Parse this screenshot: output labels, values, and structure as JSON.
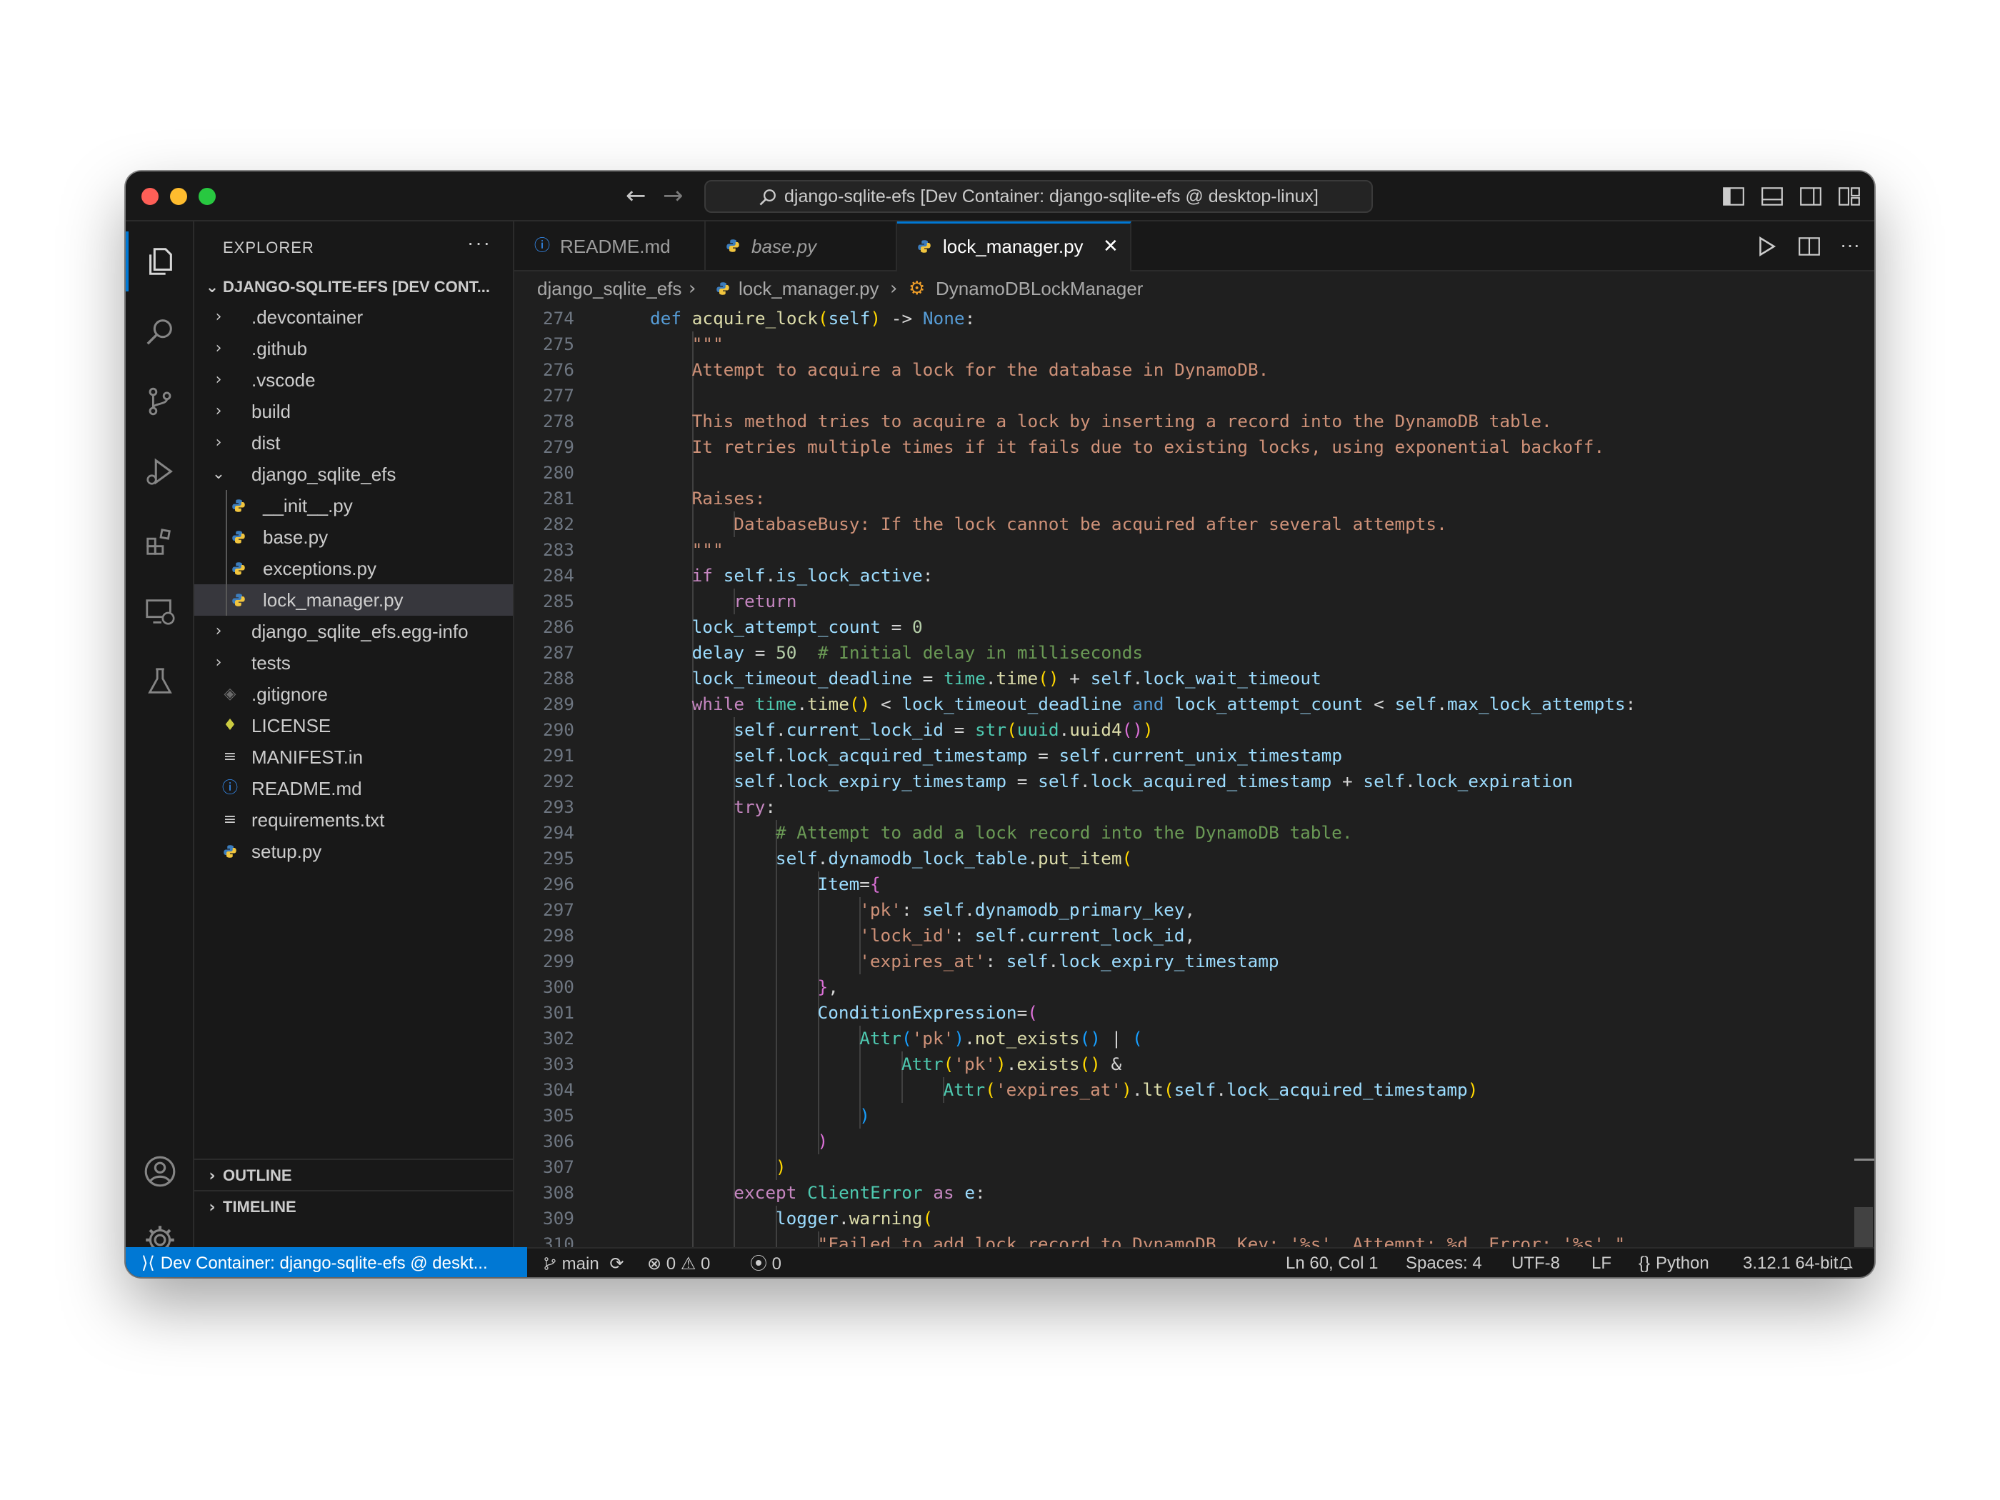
{
  "window": {
    "command_center": "django-sqlite-efs [Dev Container: django-sqlite-efs @ desktop-linux]"
  },
  "sidebar": {
    "header": "EXPLORER",
    "root": "DJANGO-SQLITE-EFS [DEV CONT...",
    "items": [
      {
        "label": ".devcontainer",
        "kind": "folder"
      },
      {
        "label": ".github",
        "kind": "folder"
      },
      {
        "label": ".vscode",
        "kind": "folder"
      },
      {
        "label": "build",
        "kind": "folder"
      },
      {
        "label": "dist",
        "kind": "folder"
      },
      {
        "label": "django_sqlite_efs",
        "kind": "folder-open"
      },
      {
        "label": "__init__.py",
        "kind": "python"
      },
      {
        "label": "base.py",
        "kind": "python"
      },
      {
        "label": "exceptions.py",
        "kind": "python"
      },
      {
        "label": "lock_manager.py",
        "kind": "python"
      },
      {
        "label": "django_sqlite_efs.egg-info",
        "kind": "folder"
      },
      {
        "label": "tests",
        "kind": "folder"
      },
      {
        "label": ".gitignore",
        "kind": "git"
      },
      {
        "label": "LICENSE",
        "kind": "license"
      },
      {
        "label": "MANIFEST.in",
        "kind": "text"
      },
      {
        "label": "README.md",
        "kind": "info"
      },
      {
        "label": "requirements.txt",
        "kind": "text"
      },
      {
        "label": "setup.py",
        "kind": "python"
      }
    ],
    "outline": "OUTLINE",
    "timeline": "TIMELINE"
  },
  "tabs": [
    {
      "label": "README.md",
      "icon": "info-icon"
    },
    {
      "label": "base.py",
      "icon": "python-icon"
    },
    {
      "label": "lock_manager.py",
      "icon": "python-icon",
      "active": true
    }
  ],
  "breadcrumb": {
    "folder": "django_sqlite_efs",
    "file": "lock_manager.py",
    "symbol": "DynamoDBLockManager"
  },
  "code": {
    "lines": [
      {
        "n": "274",
        "indent": 1,
        "tokens": [
          [
            "k",
            "def "
          ],
          [
            "f",
            "acquire_lock"
          ],
          [
            "p",
            "("
          ],
          [
            "v",
            "self"
          ],
          [
            "p",
            ")"
          ],
          [
            "o",
            " -> "
          ],
          [
            "k",
            "None"
          ],
          [
            "o",
            ":"
          ]
        ]
      },
      {
        "n": "275",
        "indent": 2,
        "tokens": [
          [
            "s",
            "\"\"\""
          ]
        ]
      },
      {
        "n": "276",
        "indent": 2,
        "tokens": [
          [
            "s",
            "Attempt to acquire a lock for the database in DynamoDB."
          ]
        ]
      },
      {
        "n": "277",
        "indent": 2,
        "tokens": []
      },
      {
        "n": "278",
        "indent": 2,
        "tokens": [
          [
            "s",
            "This method tries to acquire a lock by inserting a record into the DynamoDB table."
          ]
        ]
      },
      {
        "n": "279",
        "indent": 2,
        "tokens": [
          [
            "s",
            "It retries multiple times if it fails due to existing locks, using exponential backoff."
          ]
        ]
      },
      {
        "n": "280",
        "indent": 2,
        "tokens": []
      },
      {
        "n": "281",
        "indent": 2,
        "tokens": [
          [
            "s",
            "Raises:"
          ]
        ]
      },
      {
        "n": "282",
        "indent": 3,
        "tokens": [
          [
            "s",
            "DatabaseBusy: If the lock cannot be acquired after several attempts."
          ]
        ]
      },
      {
        "n": "283",
        "indent": 2,
        "tokens": [
          [
            "s",
            "\"\"\""
          ]
        ]
      },
      {
        "n": "284",
        "indent": 2,
        "tokens": [
          [
            "kc",
            "if "
          ],
          [
            "v",
            "self"
          ],
          [
            "o",
            "."
          ],
          [
            "v",
            "is_lock_active"
          ],
          [
            "o",
            ":"
          ]
        ]
      },
      {
        "n": "285",
        "indent": 3,
        "tokens": [
          [
            "kc",
            "return"
          ]
        ]
      },
      {
        "n": "286",
        "indent": 2,
        "tokens": [
          [
            "v",
            "lock_attempt_count"
          ],
          [
            "o",
            " = "
          ],
          [
            "n",
            "0"
          ]
        ]
      },
      {
        "n": "287",
        "indent": 2,
        "tokens": [
          [
            "v",
            "delay"
          ],
          [
            "o",
            " = "
          ],
          [
            "n",
            "50"
          ],
          [
            "c",
            "  # Initial delay in milliseconds"
          ]
        ]
      },
      {
        "n": "288",
        "indent": 2,
        "tokens": [
          [
            "v",
            "lock_timeout_deadline"
          ],
          [
            "o",
            " = "
          ],
          [
            "t",
            "time"
          ],
          [
            "o",
            "."
          ],
          [
            "f",
            "time"
          ],
          [
            "p",
            "()"
          ],
          [
            "o",
            " + "
          ],
          [
            "v",
            "self"
          ],
          [
            "o",
            "."
          ],
          [
            "v",
            "lock_wait_timeout"
          ]
        ]
      },
      {
        "n": "289",
        "indent": 2,
        "tokens": [
          [
            "kc",
            "while "
          ],
          [
            "t",
            "time"
          ],
          [
            "o",
            "."
          ],
          [
            "f",
            "time"
          ],
          [
            "p",
            "()"
          ],
          [
            "o",
            " < "
          ],
          [
            "v",
            "lock_timeout_deadline"
          ],
          [
            "k",
            " and "
          ],
          [
            "v",
            "lock_attempt_count"
          ],
          [
            "o",
            " < "
          ],
          [
            "v",
            "self"
          ],
          [
            "o",
            "."
          ],
          [
            "v",
            "max_lock_attempts"
          ],
          [
            "o",
            ":"
          ]
        ]
      },
      {
        "n": "290",
        "indent": 3,
        "tokens": [
          [
            "v",
            "self"
          ],
          [
            "o",
            "."
          ],
          [
            "v",
            "current_lock_id"
          ],
          [
            "o",
            " = "
          ],
          [
            "t",
            "str"
          ],
          [
            "p",
            "("
          ],
          [
            "t",
            "uuid"
          ],
          [
            "o",
            "."
          ],
          [
            "f",
            "uuid4"
          ],
          [
            "pp",
            "()"
          ],
          [
            "p",
            ")"
          ]
        ]
      },
      {
        "n": "291",
        "indent": 3,
        "tokens": [
          [
            "v",
            "self"
          ],
          [
            "o",
            "."
          ],
          [
            "v",
            "lock_acquired_timestamp"
          ],
          [
            "o",
            " = "
          ],
          [
            "v",
            "self"
          ],
          [
            "o",
            "."
          ],
          [
            "v",
            "current_unix_timestamp"
          ]
        ]
      },
      {
        "n": "292",
        "indent": 3,
        "tokens": [
          [
            "v",
            "self"
          ],
          [
            "o",
            "."
          ],
          [
            "v",
            "lock_expiry_timestamp"
          ],
          [
            "o",
            " = "
          ],
          [
            "v",
            "self"
          ],
          [
            "o",
            "."
          ],
          [
            "v",
            "lock_acquired_timestamp"
          ],
          [
            "o",
            " + "
          ],
          [
            "v",
            "self"
          ],
          [
            "o",
            "."
          ],
          [
            "v",
            "lock_expiration"
          ]
        ]
      },
      {
        "n": "293",
        "indent": 3,
        "tokens": [
          [
            "kc",
            "try"
          ],
          [
            "o",
            ":"
          ]
        ]
      },
      {
        "n": "294",
        "indent": 4,
        "tokens": [
          [
            "c",
            "# Attempt to add a lock record into the DynamoDB table."
          ]
        ]
      },
      {
        "n": "295",
        "indent": 4,
        "tokens": [
          [
            "v",
            "self"
          ],
          [
            "o",
            "."
          ],
          [
            "v",
            "dynamodb_lock_table"
          ],
          [
            "o",
            "."
          ],
          [
            "f",
            "put_item"
          ],
          [
            "p",
            "("
          ]
        ]
      },
      {
        "n": "296",
        "indent": 5,
        "tokens": [
          [
            "v",
            "Item"
          ],
          [
            "o",
            "="
          ],
          [
            "pp",
            "{"
          ]
        ]
      },
      {
        "n": "297",
        "indent": 6,
        "tokens": [
          [
            "s",
            "'pk'"
          ],
          [
            "o",
            ": "
          ],
          [
            "v",
            "self"
          ],
          [
            "o",
            "."
          ],
          [
            "v",
            "dynamodb_primary_key"
          ],
          [
            "o",
            ","
          ]
        ]
      },
      {
        "n": "298",
        "indent": 6,
        "tokens": [
          [
            "s",
            "'lock_id'"
          ],
          [
            "o",
            ": "
          ],
          [
            "v",
            "self"
          ],
          [
            "o",
            "."
          ],
          [
            "v",
            "current_lock_id"
          ],
          [
            "o",
            ","
          ]
        ]
      },
      {
        "n": "299",
        "indent": 6,
        "tokens": [
          [
            "s",
            "'expires_at'"
          ],
          [
            "o",
            ": "
          ],
          [
            "v",
            "self"
          ],
          [
            "o",
            "."
          ],
          [
            "v",
            "lock_expiry_timestamp"
          ]
        ]
      },
      {
        "n": "300",
        "indent": 5,
        "tokens": [
          [
            "pp",
            "}"
          ],
          [
            "o",
            ","
          ]
        ]
      },
      {
        "n": "301",
        "indent": 5,
        "tokens": [
          [
            "v",
            "ConditionExpression"
          ],
          [
            "o",
            "="
          ],
          [
            "pp",
            "("
          ]
        ]
      },
      {
        "n": "302",
        "indent": 6,
        "tokens": [
          [
            "t",
            "Attr"
          ],
          [
            "pb",
            "("
          ],
          [
            "s",
            "'pk'"
          ],
          [
            "pb",
            ")"
          ],
          [
            "o",
            "."
          ],
          [
            "f",
            "not_exists"
          ],
          [
            "pb",
            "()"
          ],
          [
            "o",
            " | "
          ],
          [
            "pb",
            "("
          ]
        ]
      },
      {
        "n": "303",
        "indent": 7,
        "tokens": [
          [
            "t",
            "Attr"
          ],
          [
            "p",
            "("
          ],
          [
            "s",
            "'pk'"
          ],
          [
            "p",
            ")"
          ],
          [
            "o",
            "."
          ],
          [
            "f",
            "exists"
          ],
          [
            "p",
            "()"
          ],
          [
            "o",
            " &"
          ]
        ]
      },
      {
        "n": "304",
        "indent": 8,
        "tokens": [
          [
            "t",
            "Attr"
          ],
          [
            "p",
            "("
          ],
          [
            "s",
            "'expires_at'"
          ],
          [
            "p",
            ")"
          ],
          [
            "o",
            "."
          ],
          [
            "f",
            "lt"
          ],
          [
            "p",
            "("
          ],
          [
            "v",
            "self"
          ],
          [
            "o",
            "."
          ],
          [
            "v",
            "lock_acquired_timestamp"
          ],
          [
            "p",
            ")"
          ]
        ]
      },
      {
        "n": "305",
        "indent": 6,
        "tokens": [
          [
            "pb",
            ")"
          ]
        ]
      },
      {
        "n": "306",
        "indent": 5,
        "tokens": [
          [
            "pp",
            ")"
          ]
        ]
      },
      {
        "n": "307",
        "indent": 4,
        "tokens": [
          [
            "p",
            ")"
          ]
        ]
      },
      {
        "n": "308",
        "indent": 3,
        "tokens": [
          [
            "kc",
            "except "
          ],
          [
            "t",
            "ClientError"
          ],
          [
            "kc",
            " as "
          ],
          [
            "v",
            "e"
          ],
          [
            "o",
            ":"
          ]
        ]
      },
      {
        "n": "309",
        "indent": 4,
        "tokens": [
          [
            "v",
            "logger"
          ],
          [
            "o",
            "."
          ],
          [
            "f",
            "warning"
          ],
          [
            "p",
            "("
          ]
        ]
      },
      {
        "n": "310",
        "indent": 5,
        "tokens": [
          [
            "s",
            "\"Failed to add lock record to DynamoDB. Key: '%s'. Attempt: %d. Error: '%s'.\""
          ]
        ]
      }
    ]
  },
  "statusbar": {
    "remote": "Dev Container: django-sqlite-efs @ deskt...",
    "branch": "main",
    "errors": "0",
    "warnings": "0",
    "ports": "0",
    "position": "Ln 60, Col 1",
    "spaces": "Spaces: 4",
    "encoding": "UTF-8",
    "eol": "LF",
    "language": "Python",
    "interpreter": "3.12.1 64-bit"
  },
  "colors": {
    "accent": "#0078d4",
    "background": "#1f1f1f"
  }
}
